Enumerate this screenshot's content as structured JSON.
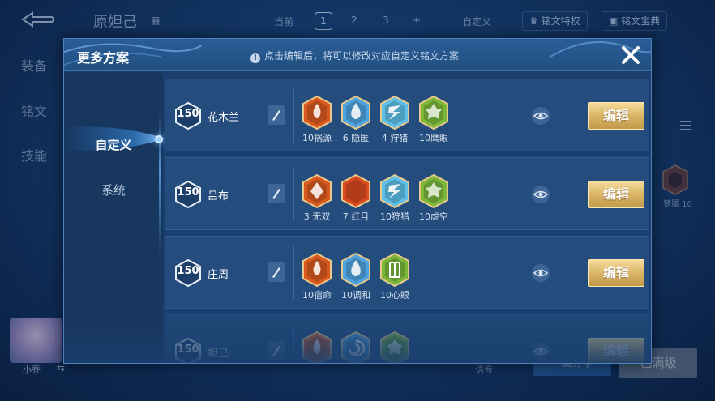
{
  "background": {
    "hero_name": "原妲己",
    "current_label": "当前",
    "slots": [
      "1",
      "2",
      "3",
      "+"
    ],
    "custom_label": "自定义",
    "rune_privilege": "铭文特权",
    "rune_treasure": "铭文宝典",
    "side_equip": "装备",
    "side_rune": "铭文",
    "side_skill": "技能",
    "avatar_name": "小乔",
    "voice_label": "语音",
    "share_button": "一键分享",
    "level_button": "已满级",
    "rune_badge": "梦魇 10"
  },
  "modal": {
    "title": "更多方案",
    "hint": "点击编辑后，将可以修改对应自定义铭文方案",
    "close_label": "×",
    "tabs": [
      {
        "label": "自定义",
        "active": true
      },
      {
        "label": "系统",
        "active": false
      }
    ],
    "edit_label": "编辑",
    "schemes": [
      {
        "level": "150",
        "name": "花木兰",
        "runes": [
          {
            "label": "10祸源",
            "color": "#d9591f",
            "icon": "flame-rune-icon"
          },
          {
            "label": "6 隐匿",
            "color": "#4fa3e0",
            "icon": "water-drop-rune-icon"
          },
          {
            "label": "4 狩猎",
            "color": "#5ec0e8",
            "icon": "lightning-rune-icon"
          },
          {
            "label": "10鹰眼",
            "color": "#7bb83a",
            "icon": "leaf-rune-icon"
          }
        ]
      },
      {
        "level": "150",
        "name": "吕布",
        "runes": [
          {
            "label": "3 无双",
            "color": "#d9591f",
            "icon": "diamond-rune-icon"
          },
          {
            "label": "7 红月",
            "color": "#d94a1f",
            "icon": "crescent-rune-icon"
          },
          {
            "label": "10狩猎",
            "color": "#5ec0e8",
            "icon": "lightning-rune-icon"
          },
          {
            "label": "10虚空",
            "color": "#7bb83a",
            "icon": "leaf-rune-icon"
          }
        ]
      },
      {
        "level": "150",
        "name": "庄周",
        "runes": [
          {
            "label": "10宿命",
            "color": "#d9591f",
            "icon": "flame-rune-icon"
          },
          {
            "label": "10调和",
            "color": "#4fa3e0",
            "icon": "water-drop-rune-icon"
          },
          {
            "label": "10心眼",
            "color": "#7bb83a",
            "icon": "gate-rune-icon"
          }
        ]
      },
      {
        "level": "150",
        "name": "妲己",
        "runes": [
          {
            "label": "",
            "color": "#d9591f",
            "icon": "flame-rune-icon"
          },
          {
            "label": "",
            "color": "#4fa3e0",
            "icon": "swirl-rune-icon"
          },
          {
            "label": "",
            "color": "#7bb83a",
            "icon": "leaf-rune-icon"
          }
        ]
      }
    ]
  }
}
